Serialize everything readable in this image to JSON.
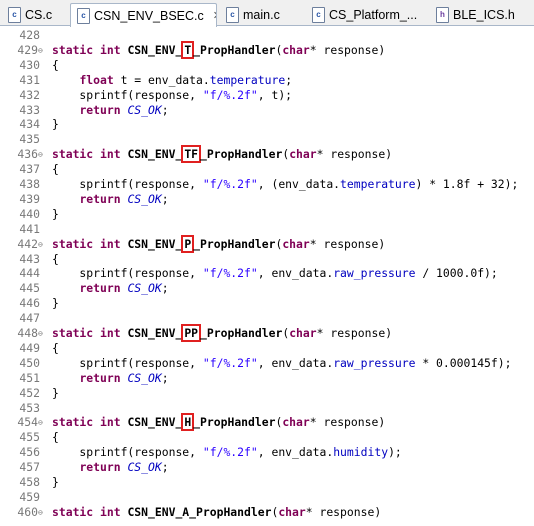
{
  "tabs": [
    {
      "label": "CS.c",
      "icon": "c-file-icon",
      "active": false
    },
    {
      "label": "CSN_ENV_BSEC.c",
      "icon": "c-file-icon",
      "active": true,
      "close": "✕"
    },
    {
      "label": "main.c",
      "icon": "c-file-icon",
      "active": false
    },
    {
      "label": "CS_Platform_...",
      "icon": "c-file-icon",
      "active": false
    },
    {
      "label": "BLE_ICS.h",
      "icon": "h-file-icon",
      "active": false
    }
  ],
  "lines": [
    {
      "n": "428",
      "fold": "",
      "segs": []
    },
    {
      "n": "429",
      "fold": "⊖",
      "segs": [
        [
          "kw",
          "static int "
        ],
        [
          "b",
          "CSN_ENV_"
        ],
        [
          "mk",
          "T"
        ],
        [
          "b",
          "_PropHandler"
        ],
        [
          "",
          "("
        ],
        [
          "type",
          "char"
        ],
        [
          "",
          "* response)"
        ]
      ]
    },
    {
      "n": "430",
      "fold": "",
      "segs": [
        [
          "",
          "{"
        ]
      ]
    },
    {
      "n": "431",
      "fold": "",
      "segs": [
        [
          "",
          "    "
        ],
        [
          "kw",
          "float"
        ],
        [
          "",
          " t = env_data."
        ],
        [
          "fld",
          "temperature"
        ],
        [
          "",
          ";"
        ]
      ]
    },
    {
      "n": "432",
      "fold": "",
      "segs": [
        [
          "",
          "    sprintf(response, "
        ],
        [
          "str",
          "\"f/%.2f\""
        ],
        [
          "",
          ", t);"
        ]
      ]
    },
    {
      "n": "433",
      "fold": "",
      "segs": [
        [
          "",
          "    "
        ],
        [
          "kw",
          "return"
        ],
        [
          "",
          " "
        ],
        [
          "it",
          "CS_OK"
        ],
        [
          "",
          ";"
        ]
      ]
    },
    {
      "n": "434",
      "fold": "",
      "segs": [
        [
          "",
          "}"
        ]
      ]
    },
    {
      "n": "435",
      "fold": "",
      "segs": []
    },
    {
      "n": "436",
      "fold": "⊖",
      "segs": [
        [
          "kw",
          "static int "
        ],
        [
          "b",
          "CSN_ENV_"
        ],
        [
          "mk",
          "TF"
        ],
        [
          "b",
          "_PropHandler"
        ],
        [
          "",
          "("
        ],
        [
          "type",
          "char"
        ],
        [
          "",
          "* response)"
        ]
      ]
    },
    {
      "n": "437",
      "fold": "",
      "segs": [
        [
          "",
          "{"
        ]
      ]
    },
    {
      "n": "438",
      "fold": "",
      "segs": [
        [
          "",
          "    sprintf(response, "
        ],
        [
          "str",
          "\"f/%.2f\""
        ],
        [
          "",
          ", (env_data."
        ],
        [
          "fld",
          "temperature"
        ],
        [
          "",
          ") * 1.8f + 32);"
        ]
      ]
    },
    {
      "n": "439",
      "fold": "",
      "segs": [
        [
          "",
          "    "
        ],
        [
          "kw",
          "return"
        ],
        [
          "",
          " "
        ],
        [
          "it",
          "CS_OK"
        ],
        [
          "",
          ";"
        ]
      ]
    },
    {
      "n": "440",
      "fold": "",
      "segs": [
        [
          "",
          "}"
        ]
      ]
    },
    {
      "n": "441",
      "fold": "",
      "segs": []
    },
    {
      "n": "442",
      "fold": "⊖",
      "segs": [
        [
          "kw",
          "static int "
        ],
        [
          "b",
          "CSN_ENV_"
        ],
        [
          "mk",
          "P"
        ],
        [
          "b",
          "_PropHandler"
        ],
        [
          "",
          "("
        ],
        [
          "type",
          "char"
        ],
        [
          "",
          "* response)"
        ]
      ]
    },
    {
      "n": "443",
      "fold": "",
      "segs": [
        [
          "",
          "{"
        ]
      ]
    },
    {
      "n": "444",
      "fold": "",
      "segs": [
        [
          "",
          "    sprintf(response, "
        ],
        [
          "str",
          "\"f/%.2f\""
        ],
        [
          "",
          ", env_data."
        ],
        [
          "fld",
          "raw_pressure"
        ],
        [
          "",
          " / 1000.0f);"
        ]
      ]
    },
    {
      "n": "445",
      "fold": "",
      "segs": [
        [
          "",
          "    "
        ],
        [
          "kw",
          "return"
        ],
        [
          "",
          " "
        ],
        [
          "it",
          "CS_OK"
        ],
        [
          "",
          ";"
        ]
      ]
    },
    {
      "n": "446",
      "fold": "",
      "segs": [
        [
          "",
          "}"
        ]
      ]
    },
    {
      "n": "447",
      "fold": "",
      "segs": []
    },
    {
      "n": "448",
      "fold": "⊖",
      "segs": [
        [
          "kw",
          "static int "
        ],
        [
          "b",
          "CSN_ENV_"
        ],
        [
          "mk",
          "PP"
        ],
        [
          "b",
          "_PropHandler"
        ],
        [
          "",
          "("
        ],
        [
          "type",
          "char"
        ],
        [
          "",
          "* response)"
        ]
      ]
    },
    {
      "n": "449",
      "fold": "",
      "segs": [
        [
          "",
          "{"
        ]
      ]
    },
    {
      "n": "450",
      "fold": "",
      "segs": [
        [
          "",
          "    sprintf(response, "
        ],
        [
          "str",
          "\"f/%.2f\""
        ],
        [
          "",
          ", env_data."
        ],
        [
          "fld",
          "raw_pressure"
        ],
        [
          "",
          " * 0.000145f);"
        ]
      ]
    },
    {
      "n": "451",
      "fold": "",
      "segs": [
        [
          "",
          "    "
        ],
        [
          "kw",
          "return"
        ],
        [
          "",
          " "
        ],
        [
          "it",
          "CS_OK"
        ],
        [
          "",
          ";"
        ]
      ]
    },
    {
      "n": "452",
      "fold": "",
      "segs": [
        [
          "",
          "}"
        ]
      ]
    },
    {
      "n": "453",
      "fold": "",
      "segs": []
    },
    {
      "n": "454",
      "fold": "⊖",
      "segs": [
        [
          "kw",
          "static int "
        ],
        [
          "b",
          "CSN_ENV_"
        ],
        [
          "mk",
          "H"
        ],
        [
          "b",
          "_PropHandler"
        ],
        [
          "",
          "("
        ],
        [
          "type",
          "char"
        ],
        [
          "",
          "* response)"
        ]
      ]
    },
    {
      "n": "455",
      "fold": "",
      "segs": [
        [
          "",
          "{"
        ]
      ]
    },
    {
      "n": "456",
      "fold": "",
      "segs": [
        [
          "",
          "    sprintf(response, "
        ],
        [
          "str",
          "\"f/%.2f\""
        ],
        [
          "",
          ", env_data."
        ],
        [
          "fld",
          "humidity"
        ],
        [
          "",
          ");"
        ]
      ]
    },
    {
      "n": "457",
      "fold": "",
      "segs": [
        [
          "",
          "    "
        ],
        [
          "kw",
          "return"
        ],
        [
          "",
          " "
        ],
        [
          "it",
          "CS_OK"
        ],
        [
          "",
          ";"
        ]
      ]
    },
    {
      "n": "458",
      "fold": "",
      "segs": [
        [
          "",
          "}"
        ]
      ]
    },
    {
      "n": "459",
      "fold": "",
      "segs": []
    },
    {
      "n": "460",
      "fold": "⊖",
      "segs": [
        [
          "kw",
          "static int "
        ],
        [
          "b",
          "CSN_ENV_A_PropHandler"
        ],
        [
          "",
          "("
        ],
        [
          "type",
          "char"
        ],
        [
          "",
          "* response)"
        ]
      ]
    }
  ]
}
